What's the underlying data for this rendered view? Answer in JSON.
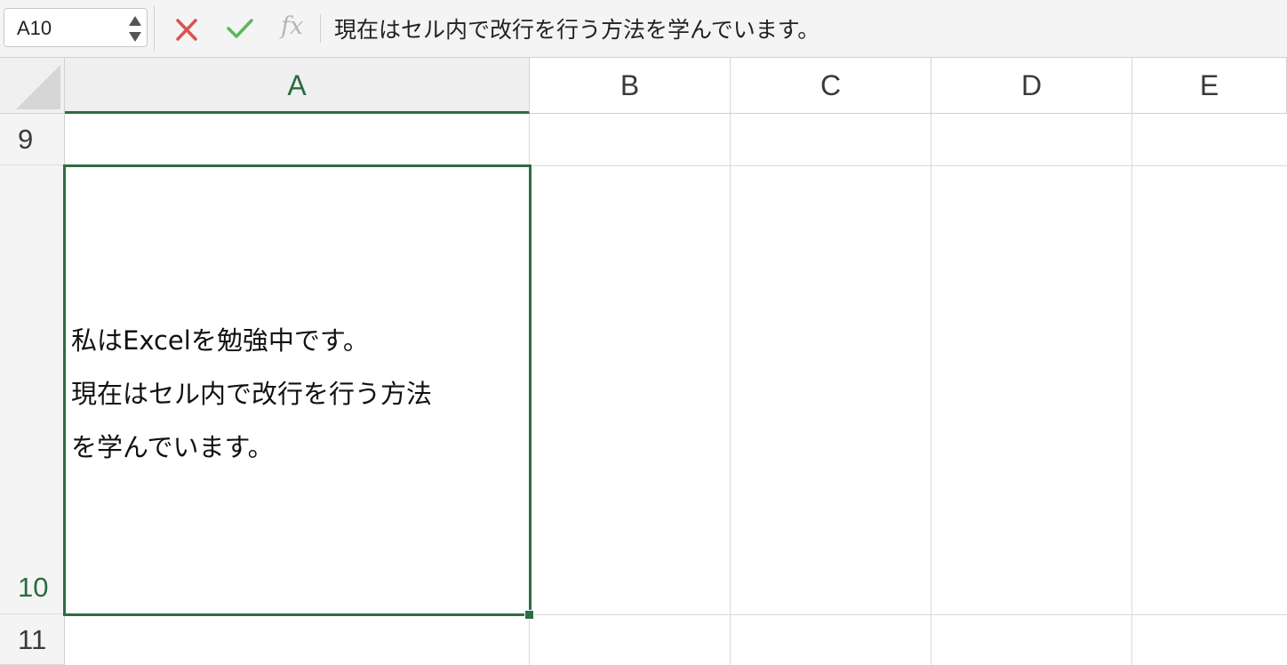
{
  "formula_bar": {
    "name_box": "A10",
    "fx_label": "fx",
    "formula_text": "現在はセル内で改行を行う方法を学んでいます。"
  },
  "columns": [
    "A",
    "B",
    "C",
    "D",
    "E"
  ],
  "rows": [
    "9",
    "10",
    "11"
  ],
  "active_cell": {
    "lines": [
      "私はExcelを勉強中です。",
      "現在はセル内で改行を行う方法",
      "を学んでいます。"
    ]
  },
  "colors": {
    "selection": "#2f6c42",
    "cancel": "#d9534f",
    "enter": "#5cb85c"
  },
  "icons": [
    "cancel-icon",
    "enter-icon",
    "name-box-stepper-icon",
    "select-all-icon"
  ]
}
